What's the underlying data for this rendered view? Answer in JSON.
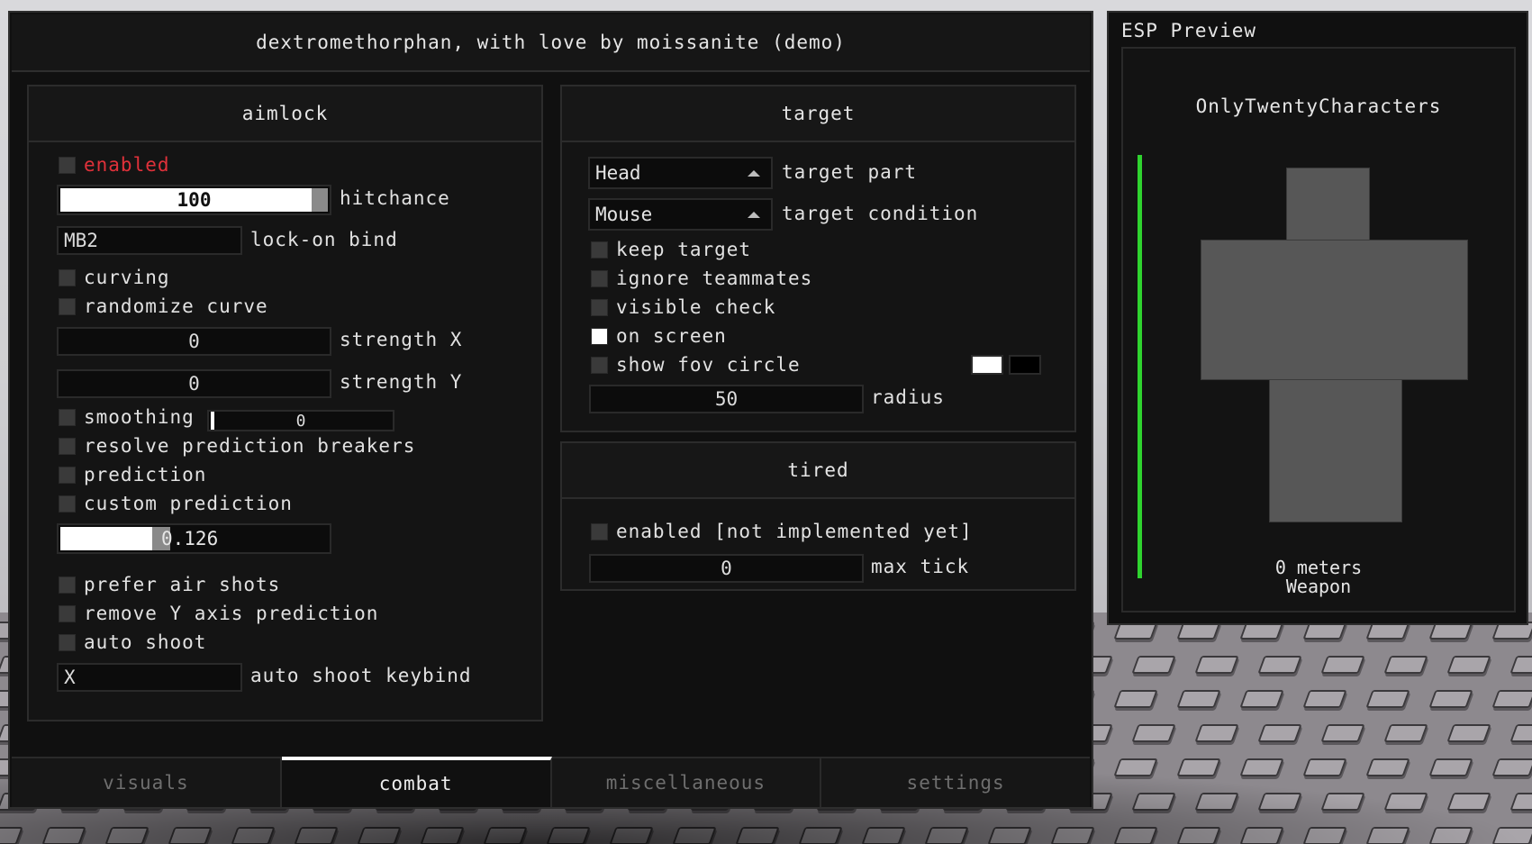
{
  "window": {
    "title": "dextromethorphan, with love by moissanite (demo)"
  },
  "aimlock": {
    "header": "aimlock",
    "enabled_label": "enabled",
    "hitchance": {
      "value": "100",
      "label": "hitchance",
      "fraction": 1.0
    },
    "lock_on_bind": {
      "value": "MB2",
      "label": "lock-on bind"
    },
    "curving_label": "curving",
    "randomize_curve_label": "randomize curve",
    "strength_x": {
      "value": "0",
      "label": "strength X"
    },
    "strength_y": {
      "value": "0",
      "label": "strength Y"
    },
    "smoothing": {
      "label": "smoothing",
      "value": "0"
    },
    "resolve_label": "resolve prediction breakers",
    "prediction_label": "prediction",
    "custom_prediction_label": "custom prediction",
    "custom_prediction_value": "0.126",
    "prefer_air_label": "prefer air shots",
    "remove_y_label": "remove Y axis prediction",
    "auto_shoot_label": "auto shoot",
    "auto_shoot_keybind": {
      "value": "X",
      "label": "auto shoot keybind"
    }
  },
  "target": {
    "header": "target",
    "part": {
      "value": "Head",
      "label": "target part"
    },
    "condition": {
      "value": "Mouse",
      "label": "target condition"
    },
    "keep_target_label": "keep target",
    "ignore_teammates_label": "ignore teammates",
    "visible_check_label": "visible check",
    "on_screen_label": "on screen",
    "on_screen_checked": true,
    "show_fov_label": "show fov circle",
    "fov_colors": [
      "#ffffff",
      "#000000"
    ],
    "radius": {
      "value": "50",
      "label": "radius"
    }
  },
  "tired": {
    "header": "tired",
    "enabled_label": "enabled [not implemented yet]",
    "max_tick": {
      "value": "0",
      "label": "max tick"
    }
  },
  "tabs": [
    {
      "label": "visuals",
      "active": false
    },
    {
      "label": "combat",
      "active": true
    },
    {
      "label": "miscellaneous",
      "active": false
    },
    {
      "label": "settings",
      "active": false
    }
  ],
  "esp": {
    "title": "ESP Preview",
    "name": "OnlyTwentyCharacters",
    "distance": "0 meters",
    "weapon": "Weapon",
    "health_color": "#2fd32f"
  },
  "colors": {
    "accent_red": "#e0313a",
    "background": "#101010",
    "border": "#2e2e2e"
  }
}
